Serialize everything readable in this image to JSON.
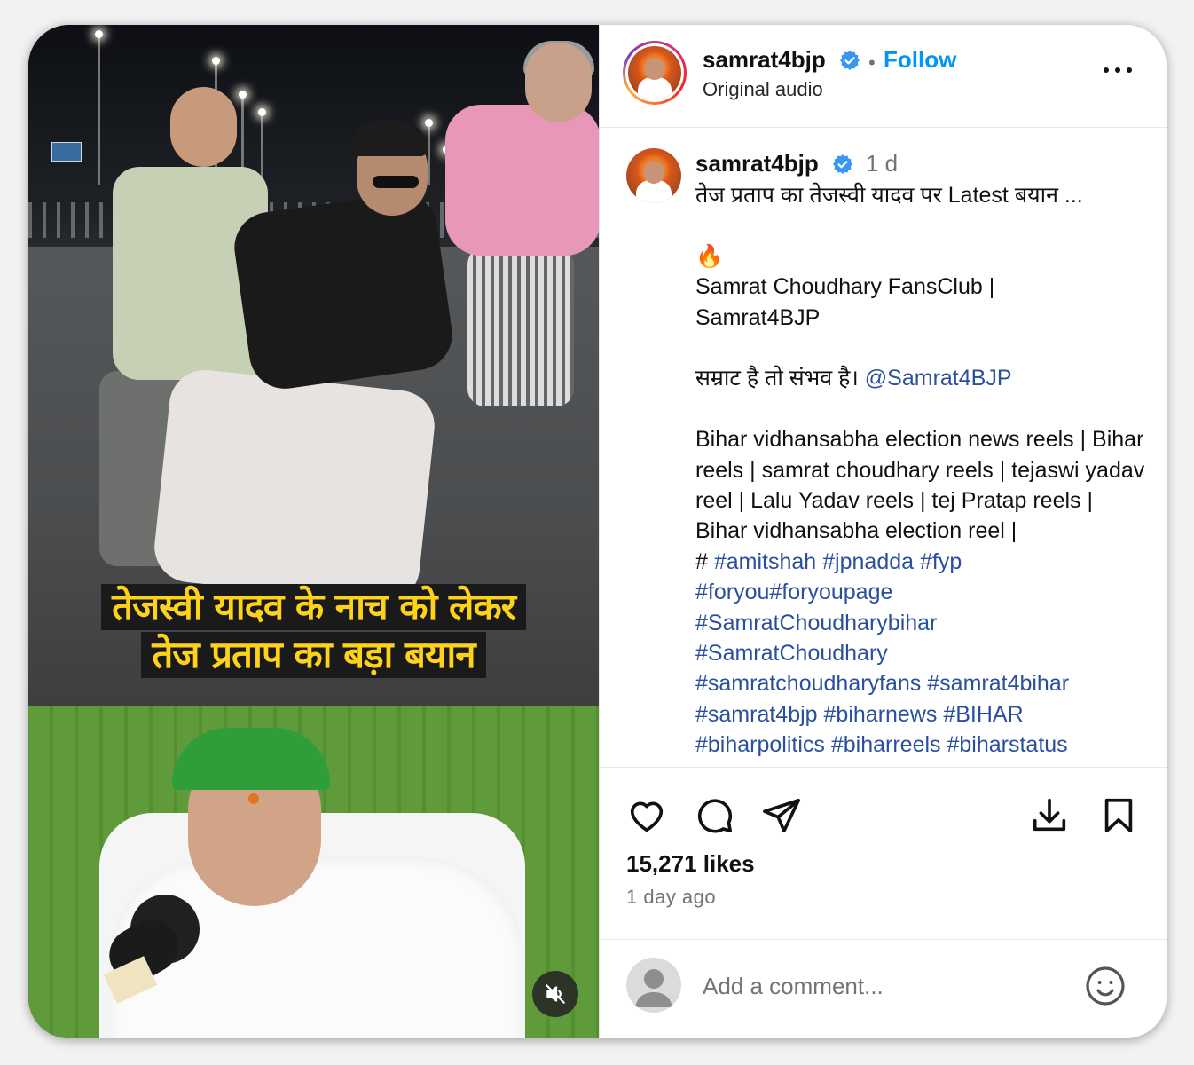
{
  "media": {
    "headline_line1": "तेजस्वी यादव के नाच को लेकर",
    "headline_line2": "तेज प्रताप का बड़ा बयान",
    "mute_icon": "speaker-muted-icon"
  },
  "header": {
    "username": "samrat4bjp",
    "separator": "•",
    "follow_label": "Follow",
    "audio_label": "Original audio",
    "more_icon": "more-horizontal-icon"
  },
  "caption": {
    "username": "samrat4bjp",
    "time": "1 d",
    "line1": "तेज प्रताप का तेजस्वी यादव पर Latest बयान ...",
    "fire": "🔥",
    "fansclub": "Samrat Choudhary FansClub | Samrat4BJP",
    "slogan": "सम्राट है तो संभव है।",
    "mention": "@Samrat4BJP",
    "reels": "Bihar vidhansabha election news reels | Bihar reels | samrat choudhary reels | tejaswi yadav reel | Lalu Yadav reels | tej Pratap reels | Bihar vidhansabha election reel |",
    "hash_prefix": "#",
    "hashtags_line1": "#amitshah #jpnadda #fyp",
    "hashtags_line2": "#foryou#foryoupage",
    "hashtags_line3": "#SamratChoudharybihar",
    "hashtags_line4": "#SamratChoudhary",
    "hashtags_line5": "#samratchoudharyfans #samrat4bihar",
    "hashtags_line6": "#samrat4bjp #biharnews #BIHAR",
    "hashtags_line7": "#biharpolitics #biharreels #biharstatus"
  },
  "actions": {
    "like_icon": "heart-icon",
    "comment_icon": "comment-bubble-icon",
    "share_icon": "paper-plane-icon",
    "download_icon": "download-icon",
    "save_icon": "bookmark-icon"
  },
  "stats": {
    "likes": "15,271 likes",
    "posted": "1 day ago"
  },
  "comment": {
    "placeholder": "Add a comment...",
    "emoji_icon": "smiley-icon"
  },
  "colors": {
    "link": "#0095f6",
    "hashtag": "#2b4f9e",
    "verified": "#3897f0",
    "headline_text": "#ffd21a",
    "headline_bg": "#1a1a1a"
  }
}
